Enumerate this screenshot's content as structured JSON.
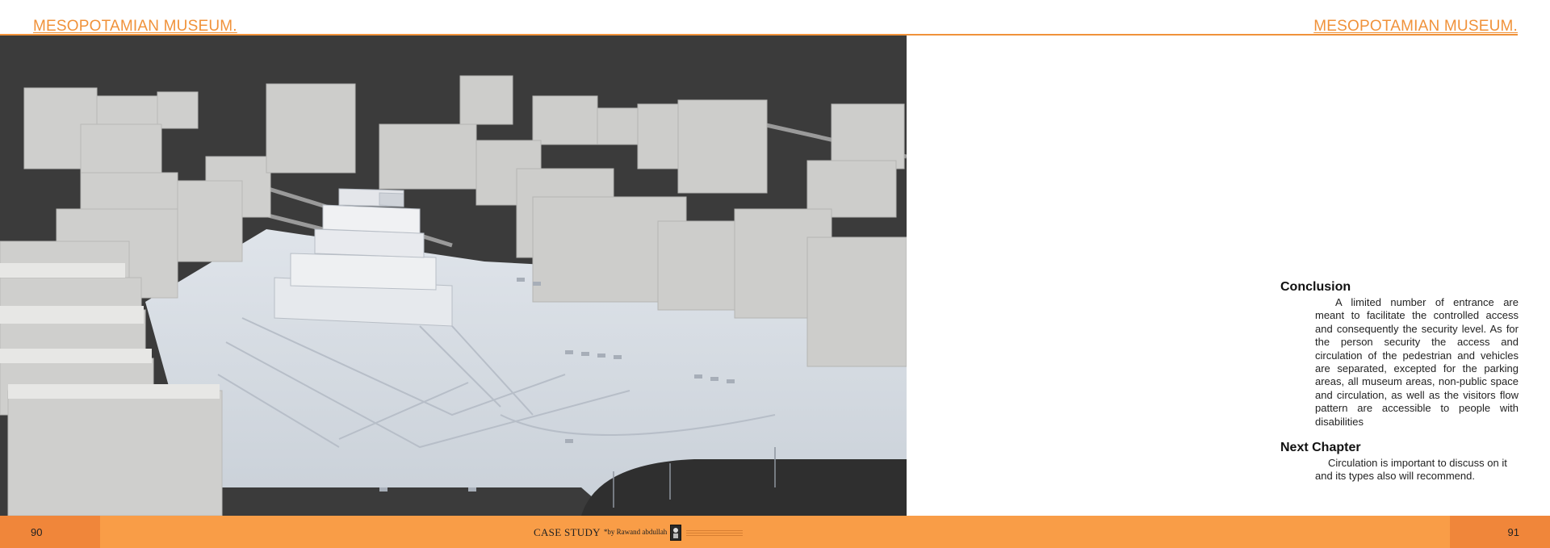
{
  "header": {
    "left_title": "MESOPOTAMIAN MUSEUM.",
    "right_title": "MESOPOTAMIAN MUSEUM."
  },
  "render_image": {
    "icon": "architectural-3d-model-render"
  },
  "conclusion": {
    "heading": "Conclusion",
    "body": "A limited number of entrance are meant to facilitate the controlled access and consequently the security level. As for the person security the access and circulation of the pedestrian and vehicles are separated, excepted for the park­ing areas, all museum areas, non-public space and circulation, as well as the visi­tors flow pattern are accessible to people with disabilities"
  },
  "next_chapter": {
    "heading": "Next Chapter",
    "body": "Circulation is important to discuss on it and its types also will recommend."
  },
  "footer": {
    "page_left": "90",
    "page_right": "91",
    "case_study": "CASE STUDY",
    "author": "*by Rawand abdullah",
    "logo_icon": "author-logo-icon"
  },
  "colors": {
    "accent": "#f0923a",
    "footer_band": "#f99d47",
    "footer_page_box": "#f0863a",
    "render_background": "#3c3c3c"
  }
}
